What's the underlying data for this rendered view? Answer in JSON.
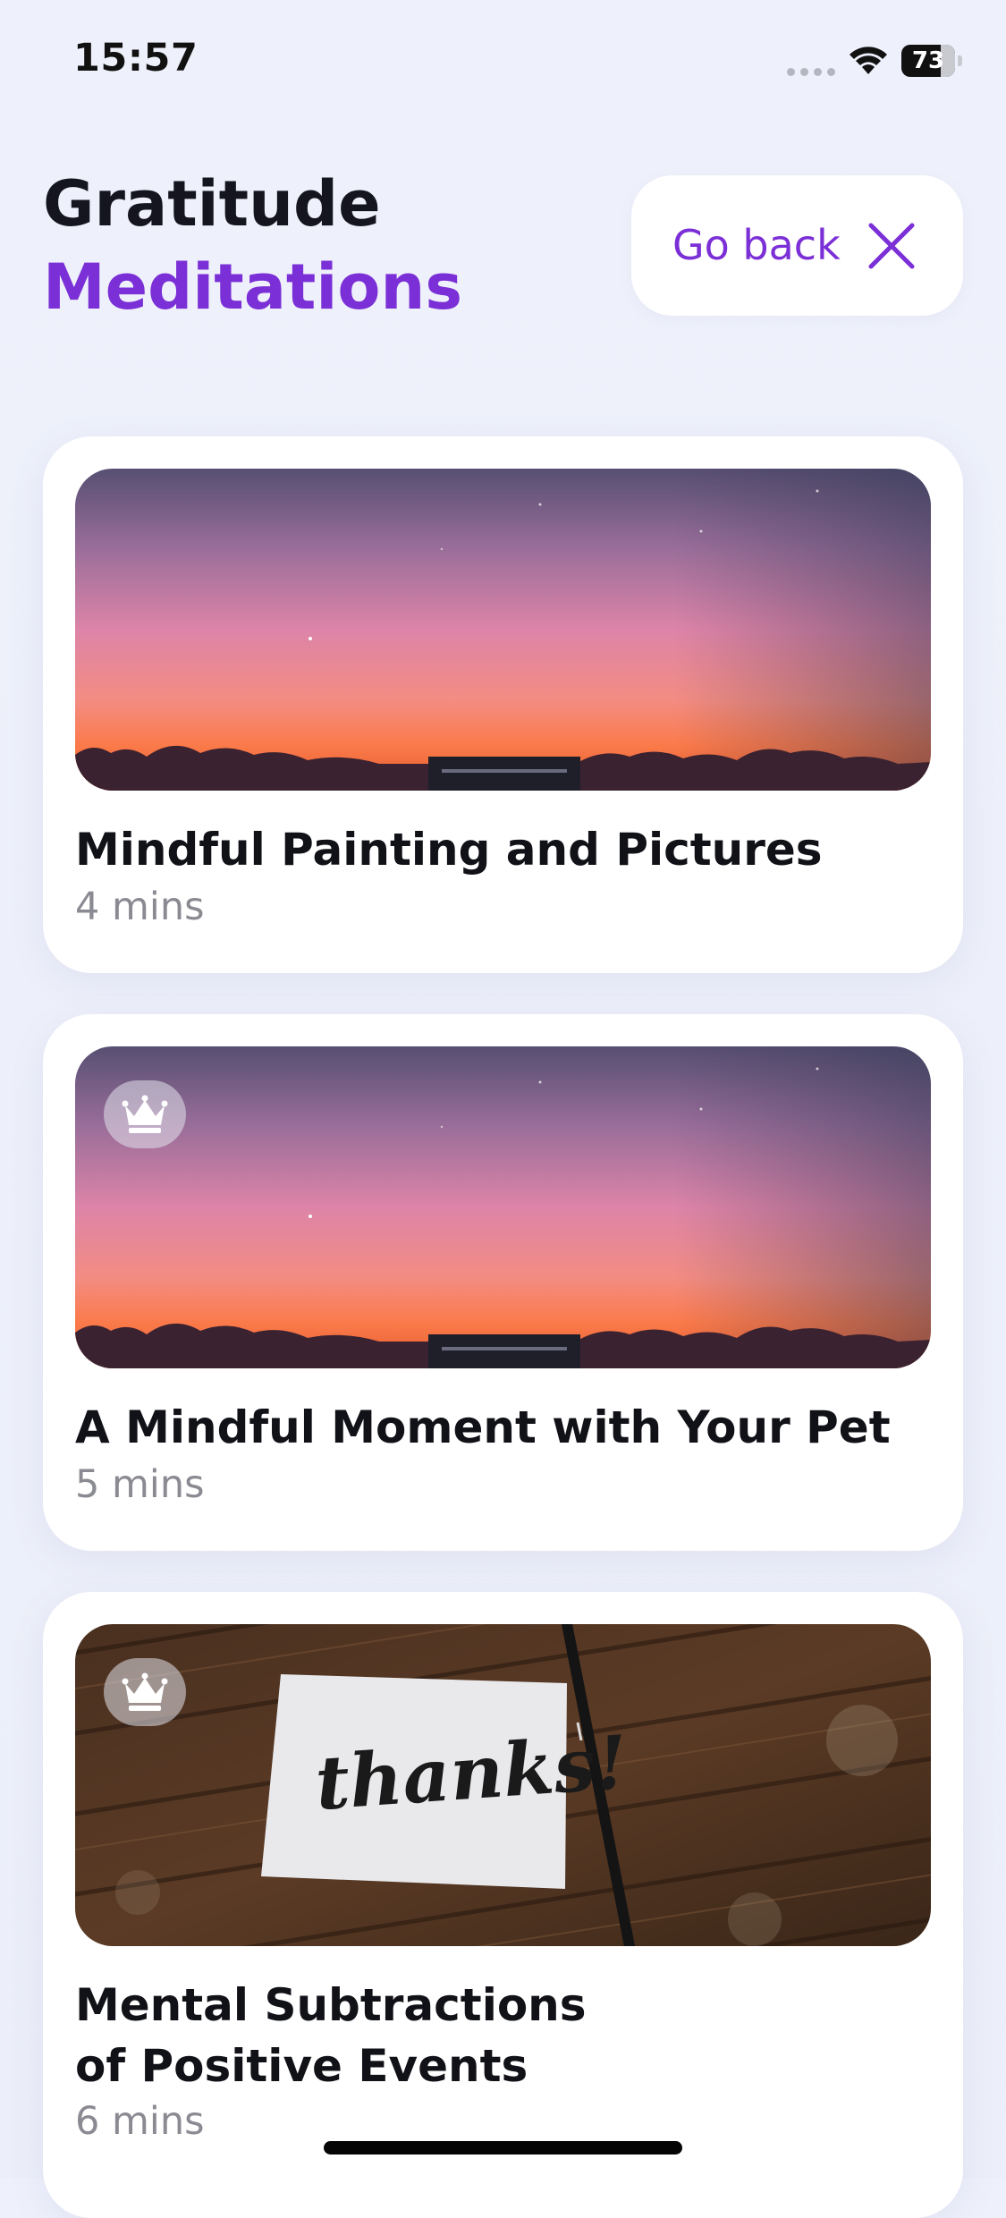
{
  "status_bar": {
    "time": "15:57",
    "battery_level": "73",
    "battery_fraction": 0.73,
    "icons": [
      "signal-dots-icon",
      "wifi-icon",
      "battery-icon"
    ]
  },
  "header": {
    "title_line1": "Gratitude",
    "title_line2": "Meditations",
    "go_back_label": "Go back",
    "go_back_icon": "close-icon"
  },
  "colors": {
    "accent": "#7b2fd6",
    "background": "#eef1fb",
    "card": "#ffffff",
    "muted_text": "#8a8a92"
  },
  "meditations": [
    {
      "title": "Mindful Painting and Pictures",
      "duration": "4 mins",
      "image": "sunset-sky-image",
      "premium": false
    },
    {
      "title": "A Mindful Moment with Your Pet",
      "duration": "5 mins",
      "image": "sunset-sky-image",
      "premium": true,
      "premium_icon": "crown-icon"
    },
    {
      "title": "Mental Subtractions of Positive Events",
      "duration": "6 mins",
      "image": "thanks-card-image",
      "image_text": "thanks!",
      "premium": true,
      "premium_icon": "crown-icon"
    }
  ]
}
